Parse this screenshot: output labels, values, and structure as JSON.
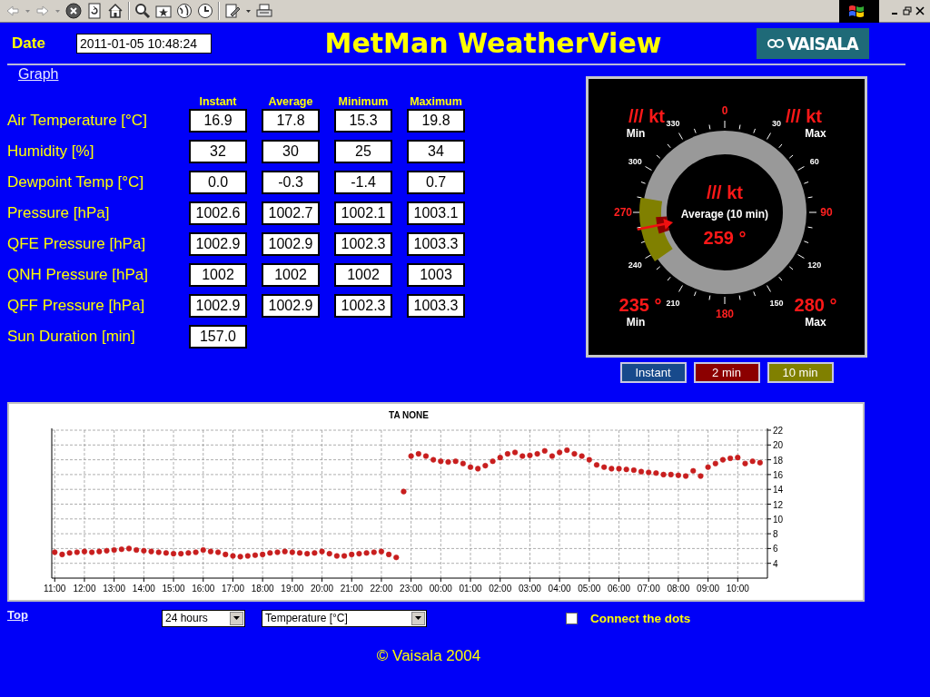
{
  "header": {
    "date_label": "Date",
    "date_value": "2011-01-05 10:48:24",
    "title": "MetMan WeatherView",
    "logo_text": "VAISALA"
  },
  "graph_link": "Graph",
  "table": {
    "columns": [
      "Instant",
      "Average",
      "Minimum",
      "Maximum"
    ],
    "rows": [
      {
        "label": "Air Temperature [°C]",
        "values": [
          "16.9",
          "17.8",
          "15.3",
          "19.8"
        ]
      },
      {
        "label": "Humidity [%]",
        "values": [
          "32",
          "30",
          "25",
          "34"
        ]
      },
      {
        "label": "Dewpoint Temp [°C]",
        "values": [
          "0.0",
          "-0.3",
          "-1.4",
          "0.7"
        ]
      },
      {
        "label": "Pressure [hPa]",
        "values": [
          "1002.6",
          "1002.7",
          "1002.1",
          "1003.1"
        ]
      },
      {
        "label": "QFE Pressure [hPa]",
        "values": [
          "1002.9",
          "1002.9",
          "1002.3",
          "1003.3"
        ]
      },
      {
        "label": "QNH Pressure [hPa]",
        "values": [
          "1002",
          "1002",
          "1002",
          "1003"
        ]
      },
      {
        "label": "QFF Pressure [hPa]",
        "values": [
          "1002.9",
          "1002.9",
          "1002.3",
          "1003.3"
        ]
      },
      {
        "label": "Sun Duration [min]",
        "values": [
          "157.0"
        ]
      }
    ]
  },
  "wind_gauge": {
    "min_speed": "/// kt",
    "min_speed_label": "Min",
    "max_speed": "/// kt",
    "max_speed_label": "Max",
    "average_speed": "/// kt",
    "average_label": "Average (10 min)",
    "average_direction": "259 °",
    "min_direction": "235 °",
    "min_direction_label": "Min",
    "max_direction": "280 °",
    "max_direction_label": "Max",
    "scale_labels": [
      "0",
      "30",
      "60",
      "90",
      "120",
      "150",
      "180",
      "210",
      "240",
      "270",
      "300",
      "330"
    ]
  },
  "gauge_buttons": [
    {
      "label": "Instant",
      "color": "#174a8c"
    },
    {
      "label": "2 min",
      "color": "#8c0000"
    },
    {
      "label": "10 min",
      "color": "#808000"
    }
  ],
  "chart": {
    "chart_data": {
      "type": "scatter",
      "title": "TA NONE",
      "categories": [
        "11:00",
        null,
        null,
        null,
        "12:00",
        null,
        null,
        null,
        "13:00",
        null,
        null,
        null,
        "14:00",
        null,
        null,
        null,
        "15:00",
        null,
        null,
        null,
        "16:00",
        null,
        null,
        null,
        "17:00",
        null,
        null,
        null,
        "18:00",
        null,
        null,
        null,
        "19:00",
        null,
        null,
        null,
        "20:00",
        null,
        null,
        null,
        "21:00",
        null,
        null,
        null,
        "22:00",
        null,
        null,
        null,
        "23:00",
        null,
        null,
        null,
        "00:00",
        null,
        null,
        null,
        "01:00",
        null,
        null,
        null,
        "02:00",
        null,
        null,
        null,
        "03:00",
        null,
        null,
        null,
        "04:00",
        null,
        null,
        null,
        "05:00",
        null,
        null,
        null,
        "06:00",
        null,
        null,
        null,
        "07:00",
        null,
        null,
        null,
        "08:00",
        null,
        null,
        null,
        "09:00",
        null,
        null,
        null,
        "10:00",
        null,
        null,
        null
      ],
      "series": [
        {
          "color": "#c81e1e",
          "values": [
            5.5,
            5.2,
            5.4,
            5.5,
            5.6,
            5.5,
            5.6,
            5.7,
            5.8,
            5.9,
            6.0,
            5.8,
            5.7,
            5.6,
            5.5,
            5.4,
            5.3,
            5.3,
            5.4,
            5.5,
            5.8,
            5.6,
            5.5,
            5.2,
            5.0,
            4.9,
            5.0,
            5.1,
            5.2,
            5.4,
            5.5,
            5.6,
            5.5,
            5.4,
            5.3,
            5.4,
            5.6,
            5.3,
            5.0,
            5.0,
            5.2,
            5.3,
            5.4,
            5.5,
            5.6,
            5.2,
            4.8,
            13.7,
            18.5,
            18.8,
            18.5,
            18.0,
            17.8,
            17.7,
            17.8,
            17.5,
            17.0,
            16.8,
            17.2,
            17.8,
            18.3,
            18.8,
            19.0,
            18.5,
            18.6,
            18.8,
            19.2,
            18.5,
            19.0,
            19.3,
            18.8,
            18.5,
            18.0,
            17.3,
            17.0,
            16.8,
            16.8,
            16.7,
            16.6,
            16.4,
            16.3,
            16.2,
            16.0,
            16.0,
            15.9,
            15.8,
            16.5,
            15.8,
            17.0,
            17.5,
            18.0,
            18.2,
            18.3,
            17.5,
            17.8,
            17.6
          ]
        }
      ],
      "ylim": [
        2,
        22
      ],
      "grid": true,
      "yticks": [
        4,
        6,
        8,
        10,
        12,
        14,
        16,
        18,
        20,
        22
      ]
    }
  },
  "footer_controls": {
    "top_link": "Top",
    "period": "24 hours",
    "quantity": "Temperature [°C]",
    "connect_dots": {
      "label": "Connect the dots",
      "checked": false
    }
  },
  "copyright": "© Vaisala 2004"
}
